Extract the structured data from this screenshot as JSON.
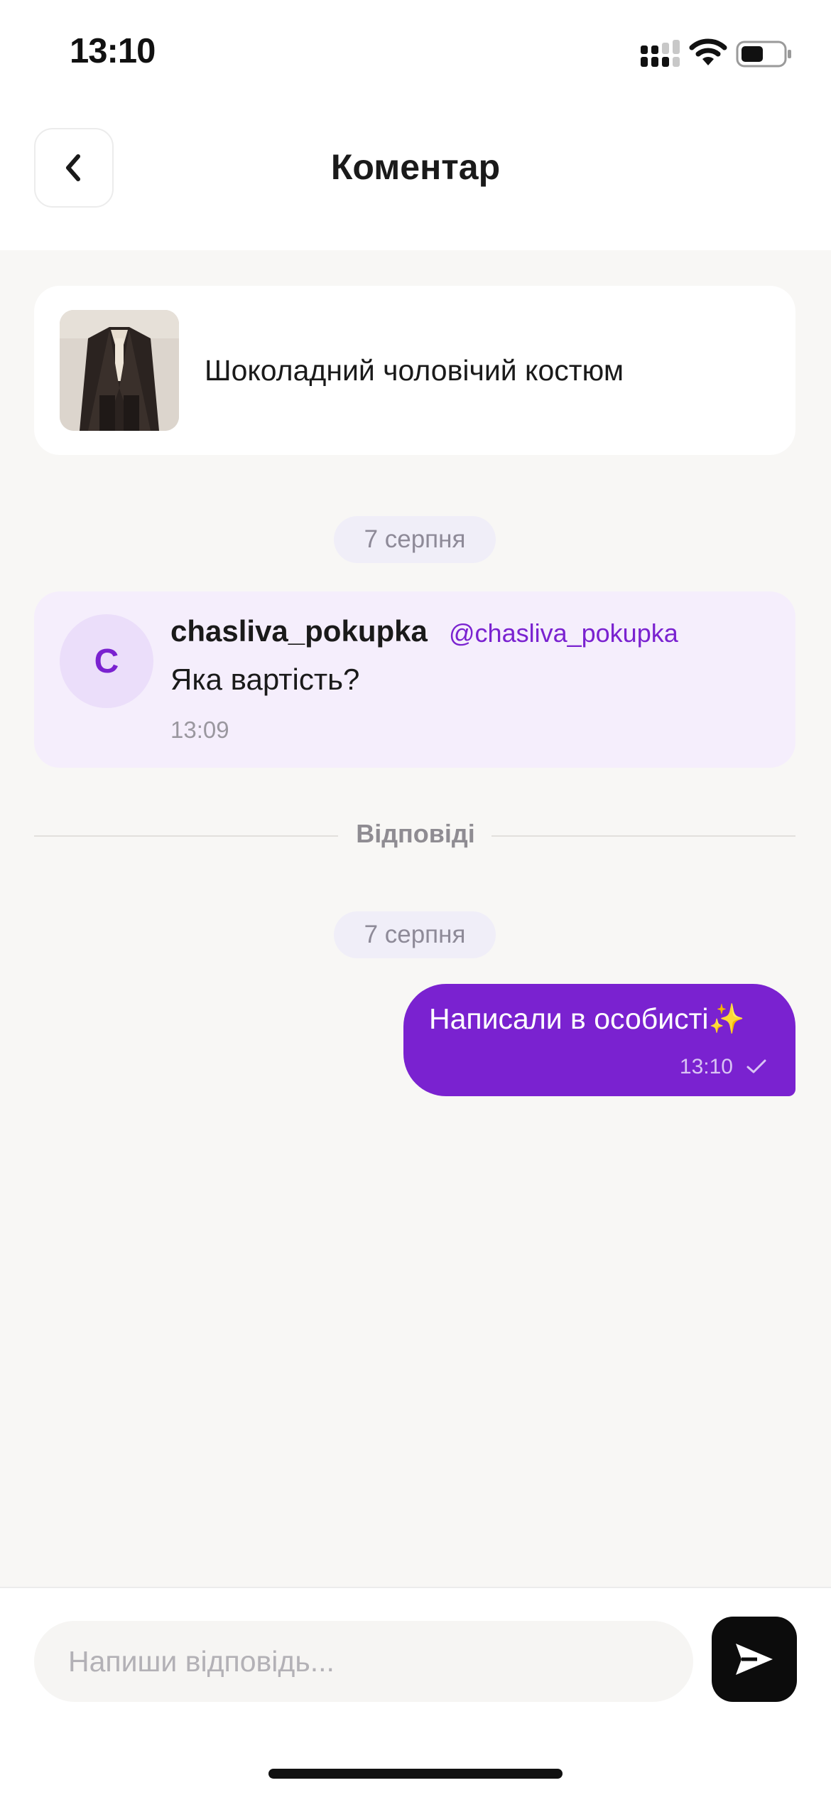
{
  "status_bar": {
    "time": "13:10",
    "icons": [
      "cellular-signal-icon",
      "wifi-icon",
      "battery-icon"
    ]
  },
  "header": {
    "back_icon": "chevron-left-icon",
    "title": "Коментар"
  },
  "product": {
    "title": "Шоколадний чоловічий костюм",
    "thumbnail": "suit-photo"
  },
  "comment": {
    "date": "7 серпня",
    "avatar_letter": "C",
    "username": "chasliva_pokupka",
    "handle": "@chasliva_pokupka",
    "text": "Яка вартість?",
    "time": "13:09"
  },
  "replies": {
    "divider_label": "Відповіді",
    "date": "7 серпня",
    "items": [
      {
        "text": "Написали в особисті✨",
        "time": "13:10",
        "status_icon": "checkmark-icon"
      }
    ]
  },
  "composer": {
    "placeholder": "Напиши відповідь...",
    "value": "",
    "send_icon": "send-arrow-icon"
  },
  "colors": {
    "accent": "#7A22D0",
    "background": "#F8F7F5",
    "comment_bg": "#F5EEFC",
    "send_button": "#0C0C0C"
  }
}
